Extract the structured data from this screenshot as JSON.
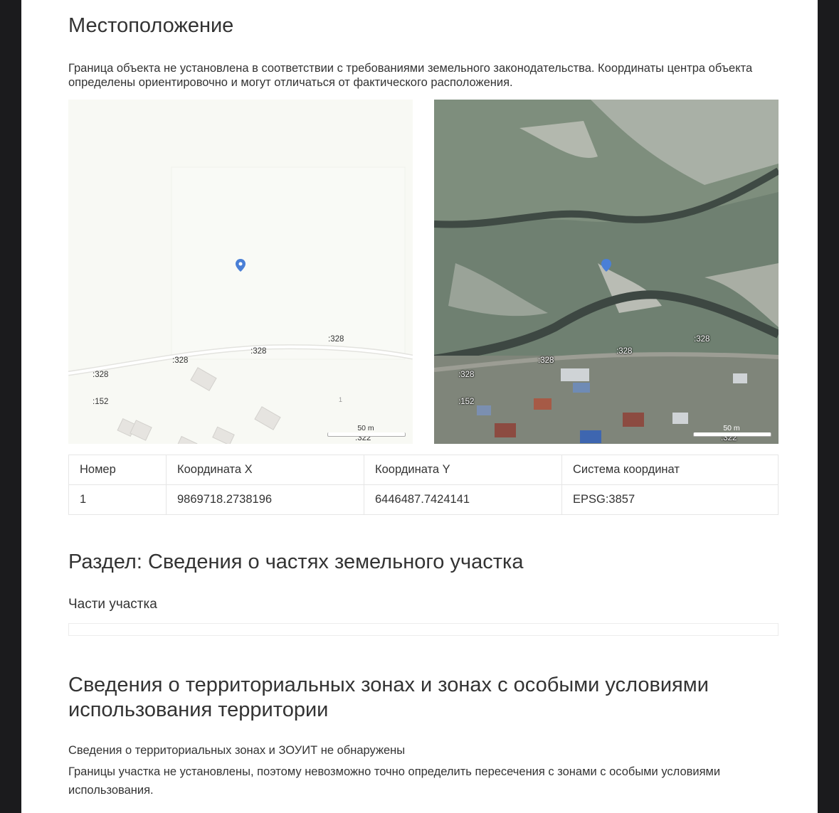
{
  "location": {
    "title": "Местоположение",
    "note": "Граница объекта не установлена в соответствии с требованиями земельного законодательства. Координаты центра объекта определены ориентировочно и могут отличаться от фактического расположения."
  },
  "map_scheme": {
    "labels": [
      ":328",
      ":328",
      ":328",
      ":328",
      ":152",
      "1",
      ":322"
    ],
    "scale_label": "50 m",
    "icon": "location-pin-icon"
  },
  "map_satellite": {
    "labels": [
      ":328",
      ":328",
      ":328",
      ":328",
      ":152",
      ":322"
    ],
    "scale_label": "50 m",
    "icon": "location-pin-icon"
  },
  "coordinates_table": {
    "headers": [
      "Номер",
      "Координата X",
      "Координата Y",
      "Система координат"
    ],
    "rows": [
      [
        "1",
        "9869718.2738196",
        "6446487.7424141",
        "EPSG:3857"
      ]
    ]
  },
  "parts_section": {
    "title": "Раздел: Сведения о частях земельного участка",
    "subtitle": "Части участка"
  },
  "zones_section": {
    "title": "Сведения о территориальных зонах и зонах с особыми условиями использования территории",
    "not_found": "Сведения о территориальных зонах и ЗОУИТ не обнаружены",
    "boundary_note": "Границы участка не установлены, поэтому невозможно точно определить пересечения с зонами с особыми условиями использования."
  },
  "colors": {
    "background": "#1b1b1d",
    "page": "#ffffff",
    "pin": "#4a7fd6"
  }
}
